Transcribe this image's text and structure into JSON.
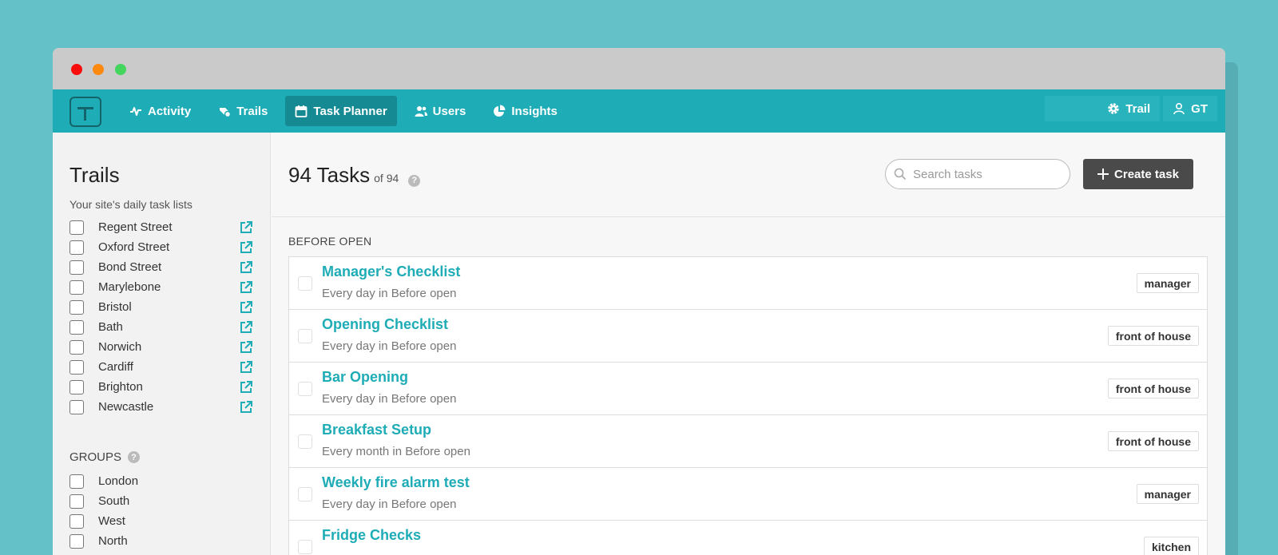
{
  "navbar": {
    "items": [
      {
        "label": "Activity",
        "icon": "activity-icon"
      },
      {
        "label": "Trails",
        "icon": "trails-icon"
      },
      {
        "label": "Task Planner",
        "icon": "calendar-icon",
        "active": true
      },
      {
        "label": "Users",
        "icon": "users-icon"
      },
      {
        "label": "Insights",
        "icon": "pie-chart-icon"
      }
    ],
    "trail_label": "Trail",
    "user_label": "GT"
  },
  "sidebar": {
    "title": "Trails",
    "subtitle": "Your site's daily task lists",
    "trails": [
      "Regent Street",
      "Oxford Street",
      "Bond Street",
      "Marylebone",
      "Bristol",
      "Bath",
      "Norwich",
      "Cardiff",
      "Brighton",
      "Newcastle"
    ],
    "groups_title": "GROUPS",
    "groups": [
      "London",
      "South",
      "West",
      "North"
    ]
  },
  "main": {
    "task_count": "94 Tasks",
    "task_total": "of 94",
    "search_placeholder": "Search tasks",
    "create_label": "Create task",
    "section": "BEFORE OPEN",
    "tasks": [
      {
        "name": "Manager's Checklist",
        "desc": "Every day in Before open",
        "tag": "manager"
      },
      {
        "name": "Opening Checklist",
        "desc": "Every day in Before open",
        "tag": "front of house"
      },
      {
        "name": "Bar Opening",
        "desc": "Every day in Before open",
        "tag": "front of house"
      },
      {
        "name": "Breakfast Setup",
        "desc": "Every month in Before open",
        "tag": "front of house"
      },
      {
        "name": "Weekly fire alarm test",
        "desc": "Every day in Before open",
        "tag": "manager"
      },
      {
        "name": "Fridge Checks",
        "desc": "",
        "tag": "kitchen"
      }
    ]
  },
  "colors": {
    "accent": "#1eacb6",
    "background": "#63c1c7",
    "dark_button": "#4a4a4a"
  }
}
